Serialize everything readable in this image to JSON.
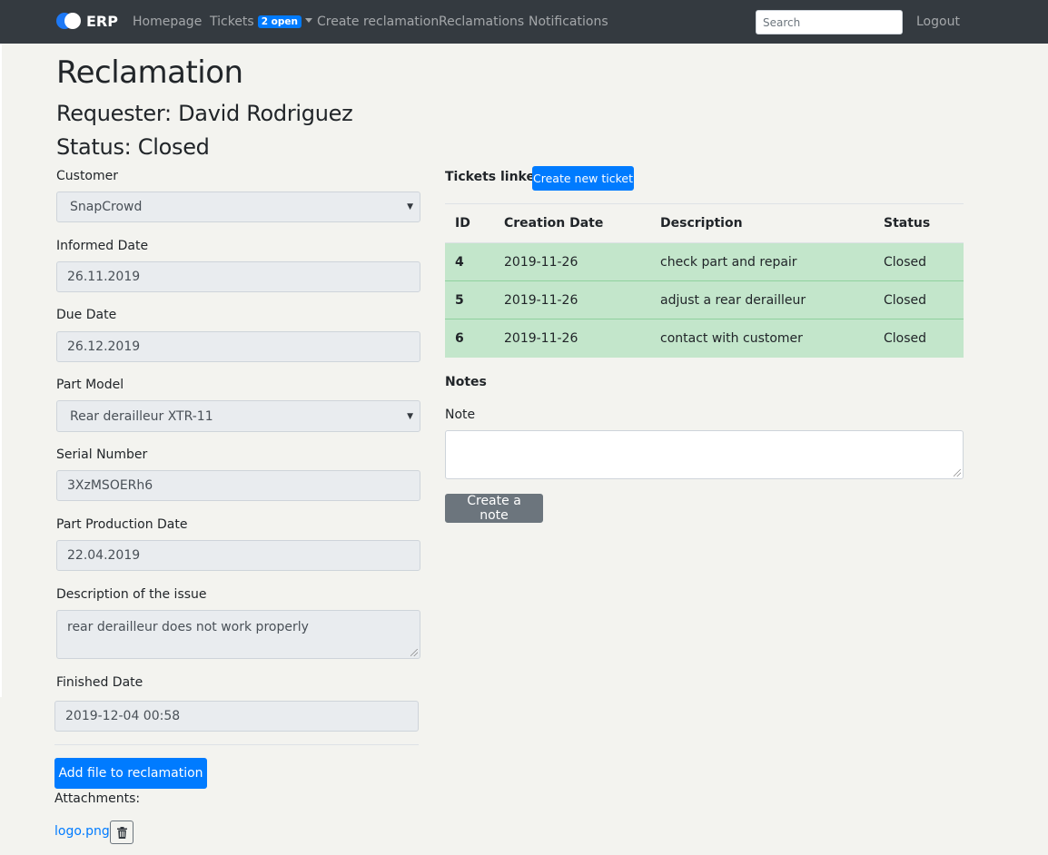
{
  "navbar": {
    "brand": "ERP",
    "links": {
      "homepage": "Homepage",
      "tickets": "Tickets",
      "tickets_badge": "2 open",
      "create_reclamation": "Create reclamation",
      "reclamations": "Reclamations",
      "notifications": "Notifications",
      "logout": "Logout"
    },
    "search_placeholder": "Search"
  },
  "page": {
    "title": "Reclamation",
    "requester": "Requester: David Rodriguez",
    "status": "Status: Closed"
  },
  "form": {
    "customer": {
      "label": "Customer",
      "value": "SnapCrowd"
    },
    "informed_date": {
      "label": "Informed Date",
      "value": "26.11.2019"
    },
    "due_date": {
      "label": "Due Date",
      "value": "26.12.2019"
    },
    "part_model": {
      "label": "Part Model",
      "value": "Rear derailleur XTR-11"
    },
    "serial_number": {
      "label": "Serial Number",
      "value": "3XzMSOERh6"
    },
    "part_production_date": {
      "label": "Part Production Date",
      "value": "22.04.2019"
    },
    "description": {
      "label": "Description of the issue",
      "value": "rear derailleur does not work properly"
    },
    "finished_date": {
      "label": "Finished Date",
      "value": "2019-12-04 00:58"
    }
  },
  "attachments": {
    "add_button": "Add file to reclamation",
    "label": "Attachments:",
    "files": [
      "logo.png"
    ]
  },
  "tickets": {
    "heading": "Tickets linked",
    "create_button": "Create new ticket",
    "columns": [
      "ID",
      "Creation Date",
      "Description",
      "Status"
    ],
    "rows": [
      {
        "id": "4",
        "date": "2019-11-26",
        "description": "check part and repair",
        "status": "Closed"
      },
      {
        "id": "5",
        "date": "2019-11-26",
        "description": "adjust a rear derailleur",
        "status": "Closed"
      },
      {
        "id": "6",
        "date": "2019-11-26",
        "description": "contact with customer",
        "status": "Closed"
      }
    ]
  },
  "notes": {
    "heading": "Notes",
    "label": "Note",
    "value": "",
    "create_button": "Create a note"
  },
  "colors": {
    "navbar": "#343a40",
    "primary": "#007bff",
    "secondary": "#6c757d",
    "row_success": "#c3e6cb",
    "background": "#f3f3ef"
  }
}
